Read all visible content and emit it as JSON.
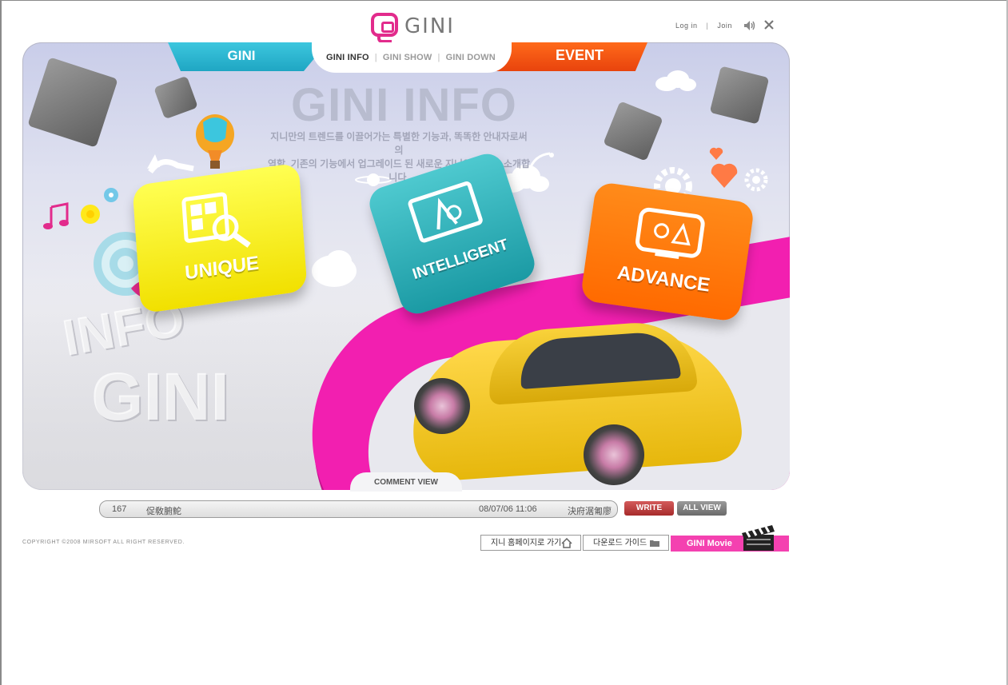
{
  "brand": {
    "logo_text": "GINI",
    "accent": "#e22b8c"
  },
  "header": {
    "login_label": "Log in",
    "join_label": "Join",
    "separator": "|"
  },
  "tabs": {
    "gini_label": "GINI",
    "event_label": "EVENT",
    "subnav": [
      {
        "label": "GINI INFO",
        "active": true
      },
      {
        "label": "GINI SHOW",
        "active": false
      },
      {
        "label": "GINI DOWN",
        "active": false
      }
    ]
  },
  "hero": {
    "title": "GINI INFO",
    "desc_line1": "지니만의 트렌드를 이끌어가는 특별한 기능과, 똑똑한 안내자로써의",
    "desc_line2": "역할, 기존의 기능에서 업그레이드 된 새로운 지니의 기능을 소개합니다.",
    "tiles": [
      {
        "label": "UNIQUE",
        "color": "#f5e800"
      },
      {
        "label": "INTELLIGENT",
        "color": "#2bb0b8"
      },
      {
        "label": "ADVANCE",
        "color": "#ff7400"
      }
    ],
    "bg_text_1": "INFO",
    "bg_text_2": "GINI",
    "road_color": "#f21fb0"
  },
  "comment": {
    "tab_label": "COMMENT VIEW",
    "number": "167",
    "text": "促敎腑鮀",
    "date": "08/07/06 11:06",
    "author": "決府涺匍廖",
    "write_label": "WRITE",
    "allview_label": "ALL VIEW"
  },
  "footer": {
    "copyright": "COPYRIGHT ©2008 MIRSOFT ALL RIGHT RESERVED.",
    "home_label": "지니 홈페이지로 가기",
    "guide_label": "다운로드 가이드",
    "movie_label": "GINI Movie"
  }
}
